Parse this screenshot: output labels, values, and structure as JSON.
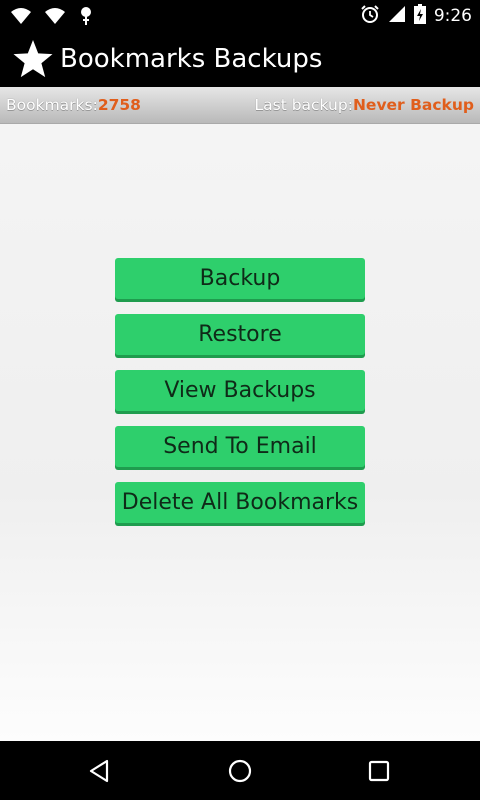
{
  "status_bar": {
    "time": "9:26",
    "icons_left": [
      "wifi-icon",
      "wifi-icon",
      "android-debug-icon"
    ],
    "icons_right": [
      "alarm-icon",
      "cell-signal-icon",
      "battery-icon"
    ]
  },
  "app_bar": {
    "title": "Bookmarks Backups",
    "icon": "star-icon"
  },
  "info": {
    "bookmarks_label": "Bookmarks:",
    "bookmarks_count": "2758",
    "last_backup_label": "Last backup:",
    "last_backup_value": "Never Backup"
  },
  "actions": {
    "backup": "Backup",
    "restore": "Restore",
    "view_backups": "View Backups",
    "send_to_email": "Send To Email",
    "delete_all": "Delete All Bookmarks"
  },
  "nav": {
    "icons": [
      "back-icon",
      "home-icon",
      "recents-icon"
    ]
  },
  "colors": {
    "button_green": "#2ecf6c",
    "accent_orange": "#e05e1c"
  }
}
